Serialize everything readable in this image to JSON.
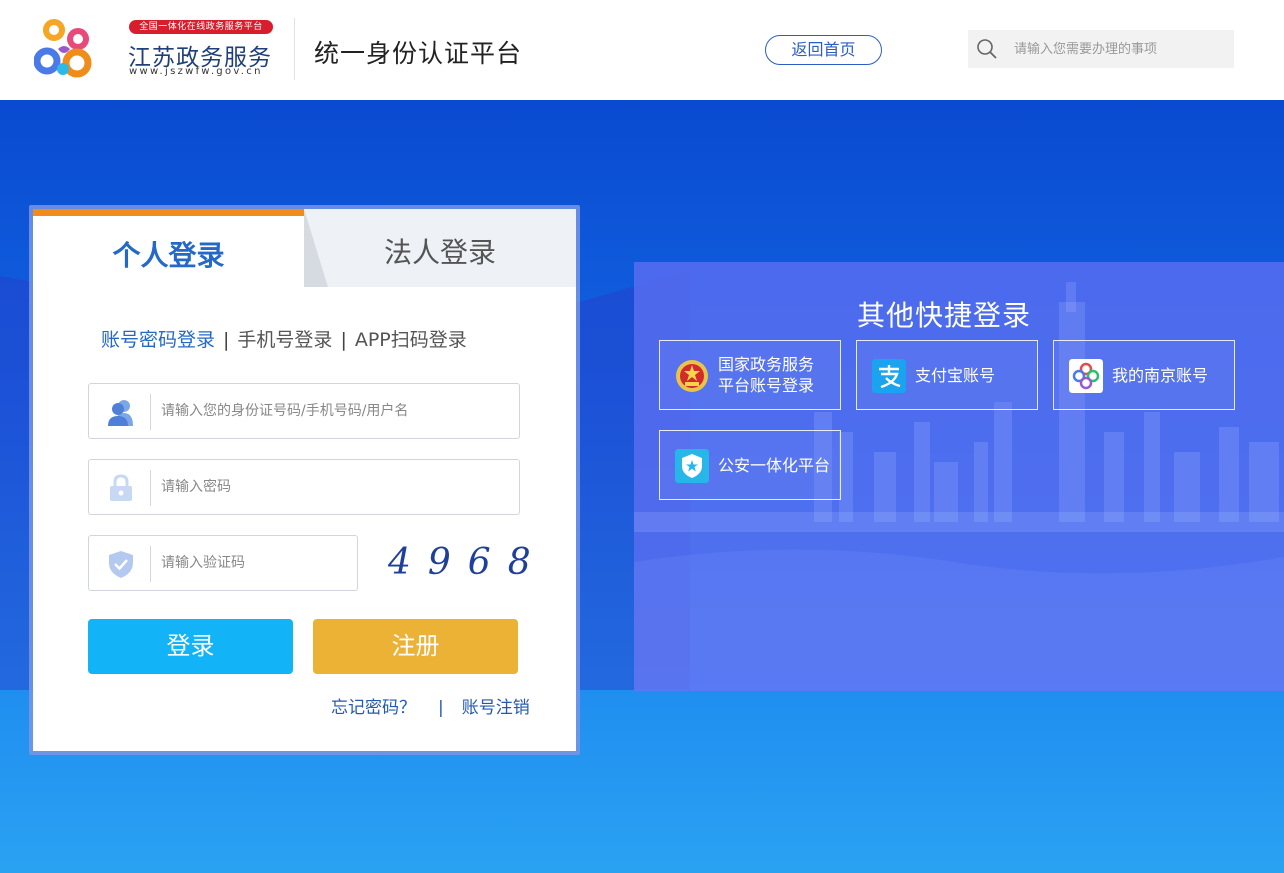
{
  "header": {
    "badge": "全国一体化在线政务服务平台",
    "brand_name": "江苏政务服务",
    "brand_url": "www.jszwfw.gov.cn",
    "platform_title": "统一身份认证平台",
    "home_button": "返回首页",
    "search_placeholder": "请输入您需要办理的事项"
  },
  "login": {
    "tabs": [
      {
        "label": "个人登录",
        "active": true
      },
      {
        "label": "法人登录",
        "active": false
      }
    ],
    "modes": [
      {
        "label": "账号密码登录",
        "active": true
      },
      {
        "label": "手机号登录",
        "active": false
      },
      {
        "label": "APP扫码登录",
        "active": false
      }
    ],
    "mode_separator": "|",
    "username_placeholder": "请输入您的身份证号码/手机号码/用户名",
    "password_placeholder": "请输入密码",
    "captcha_placeholder": "请输入验证码",
    "captcha_text": "4968",
    "login_button": "登录",
    "register_button": "注册",
    "forgot_link": "忘记密码？",
    "link_separator": "|",
    "cancel_link": "账号注销"
  },
  "quick": {
    "title": "其他快捷登录",
    "options": [
      {
        "label": "国家政务服务平台账号登录",
        "line1": "国家政务服务",
        "line2": "平台账号登录",
        "icon": "national-emblem-icon"
      },
      {
        "label": "支付宝账号",
        "icon": "alipay-icon"
      },
      {
        "label": "我的南京账号",
        "icon": "my-nanjing-icon"
      },
      {
        "label": "公安一体化平台",
        "icon": "police-badge-icon"
      }
    ]
  },
  "colors": {
    "accent": "#2469c7",
    "tab_highlight": "#f08c1a",
    "login_button": "#12b3f7",
    "register_button": "#ecb236",
    "badge_red": "#d81e2c"
  }
}
